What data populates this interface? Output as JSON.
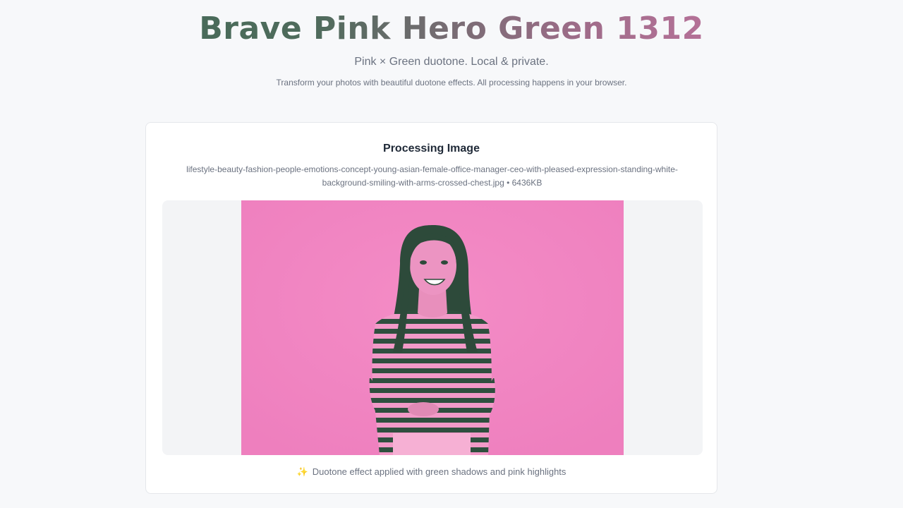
{
  "header": {
    "title": "Brave Pink Hero Green 1312",
    "tagline": "Pink × Green duotone. Local & private.",
    "description": "Transform your photos with beautiful duotone effects. All processing happens in your browser."
  },
  "card": {
    "title": "Processing Image",
    "file_info": "lifestyle-beauty-fashion-people-emotions-concept-young-asian-female-office-manager-ceo-with-pleased-expression-standing-white-background-smiling-with-arms-crossed-chest.jpg • 6436KB",
    "status_icon": "sparkle-icon",
    "status_text": "Duotone effect applied with green shadows and pink highlights"
  },
  "colors": {
    "green_shadow": "#2d5a45",
    "pink_highlight": "#f080c0"
  }
}
